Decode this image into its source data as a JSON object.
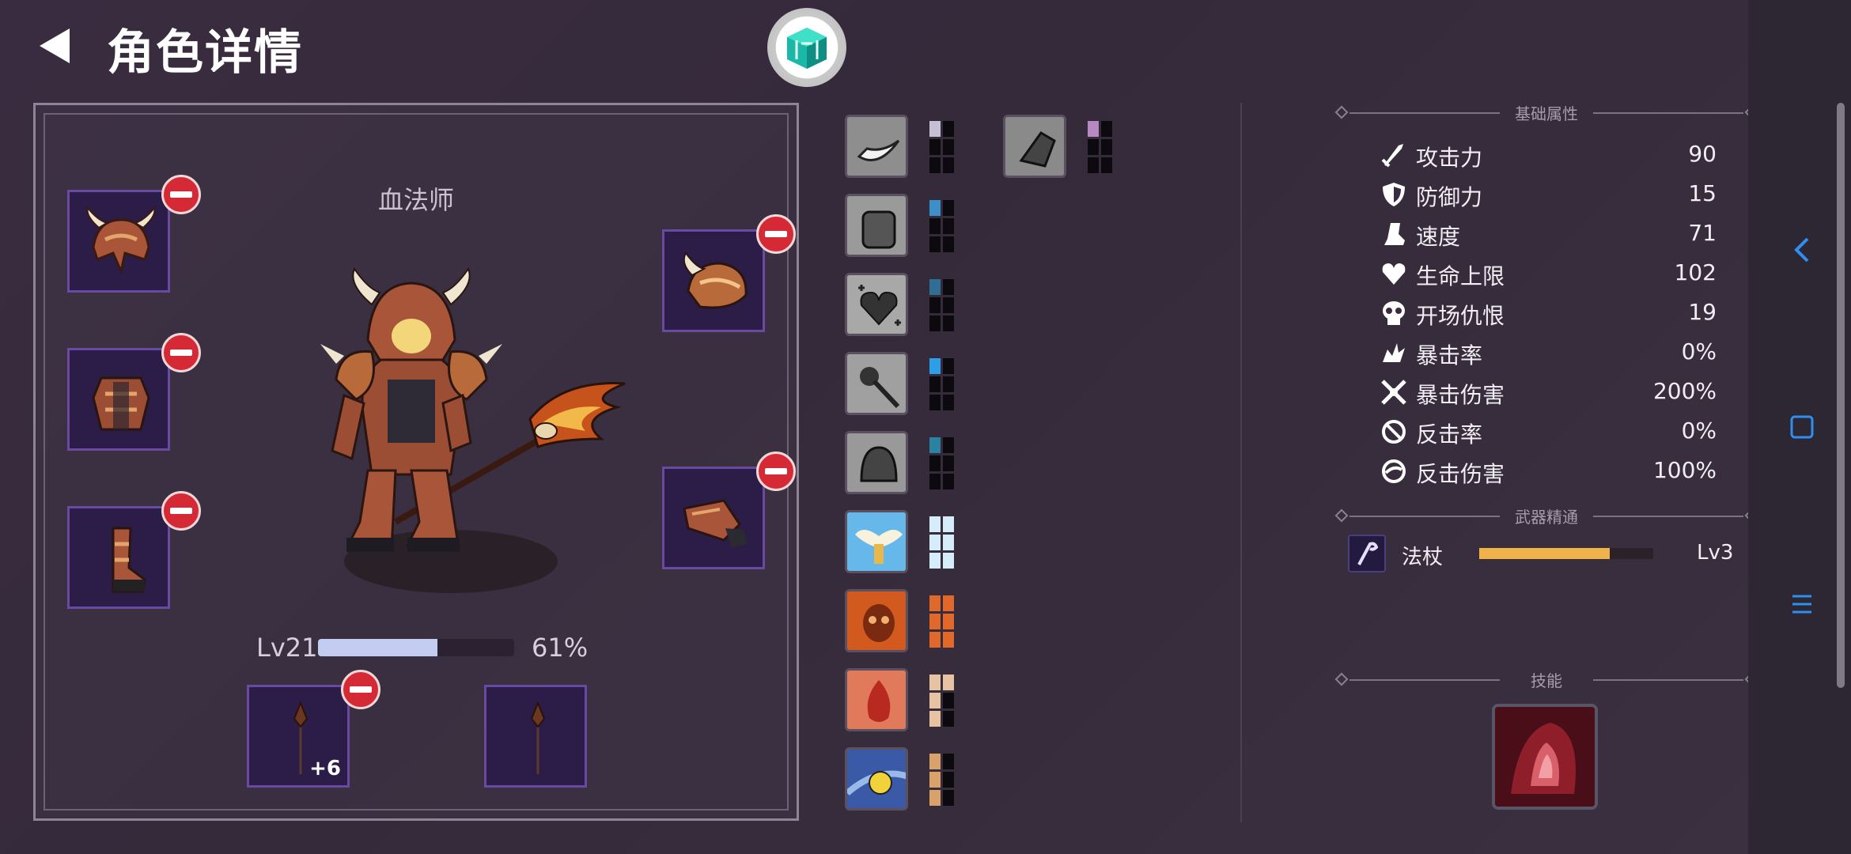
{
  "header": {
    "title": "角色详情"
  },
  "character": {
    "name": "血法师",
    "level_label": "Lv21",
    "xp_percent_label": "61%",
    "xp_fraction": 0.61
  },
  "equipment": {
    "weapon_plus_label": "+6"
  },
  "stats_section": {
    "title": "基础属性",
    "rows": [
      {
        "name": "攻击力",
        "value": "90",
        "icon": "sword-icon"
      },
      {
        "name": "防御力",
        "value": "15",
        "icon": "shield-icon"
      },
      {
        "name": "速度",
        "value": "71",
        "icon": "boot-icon"
      },
      {
        "name": "生命上限",
        "value": "102",
        "icon": "heart-icon"
      },
      {
        "name": "开场仇恨",
        "value": "19",
        "icon": "skull-icon"
      },
      {
        "name": "暴击率",
        "value": "0%",
        "icon": "crit-icon"
      },
      {
        "name": "暴击伤害",
        "value": "200%",
        "icon": "crit-damage-icon"
      },
      {
        "name": "反击率",
        "value": "0%",
        "icon": "counter-icon"
      },
      {
        "name": "反击伤害",
        "value": "100%",
        "icon": "counter-damage-icon"
      }
    ]
  },
  "mastery_section": {
    "title": "武器精通",
    "weapon": "法杖",
    "level": "Lv3",
    "progress_fraction": 0.75
  },
  "skills_section": {
    "title": "技能"
  },
  "colors": {
    "accent_blue": "#2f8ff0",
    "remove_red": "#d52a35",
    "slot_purple": "#2b1c48",
    "mastery_bar": "#f0b24a",
    "xp_bar": "#c3cdf2"
  }
}
